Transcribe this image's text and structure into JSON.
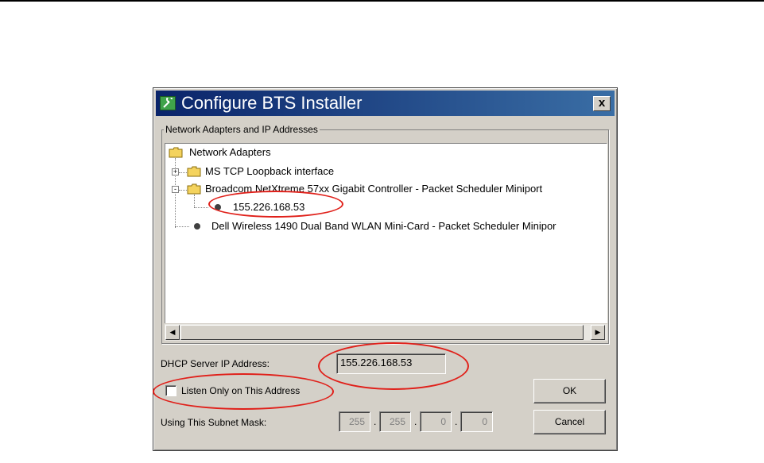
{
  "dialog": {
    "title": "Configure BTS Installer",
    "close_label": "x"
  },
  "group": {
    "legend": "Network Adapters and IP Addresses"
  },
  "tree": {
    "root": "Network Adapters",
    "items": [
      {
        "label": "MS TCP Loopback interface",
        "expander": "+"
      },
      {
        "label": "Broadcom NetXtreme 57xx Gigabit Controller - Packet Scheduler Miniport",
        "expander": "-"
      },
      {
        "label": "155.226.168.53"
      },
      {
        "label": "Dell Wireless 1490 Dual Band WLAN Mini-Card - Packet Scheduler Minipor"
      }
    ]
  },
  "scrollbar": {
    "left_arrow": "◀",
    "right_arrow": "▶"
  },
  "dhcp": {
    "label": "DHCP Server IP Address:",
    "value": "155.226.168.53"
  },
  "listen": {
    "label": "Listen Only on This Address",
    "checked": false
  },
  "subnet": {
    "label": "Using This Subnet Mask:",
    "octets": [
      "255",
      "255",
      "0",
      "0"
    ],
    "separator": "."
  },
  "buttons": {
    "ok": "OK",
    "cancel": "Cancel"
  },
  "colors": {
    "annotation": "#e0201a",
    "titlebar_start": "#0a246a",
    "titlebar_end": "#3a6ea5"
  }
}
